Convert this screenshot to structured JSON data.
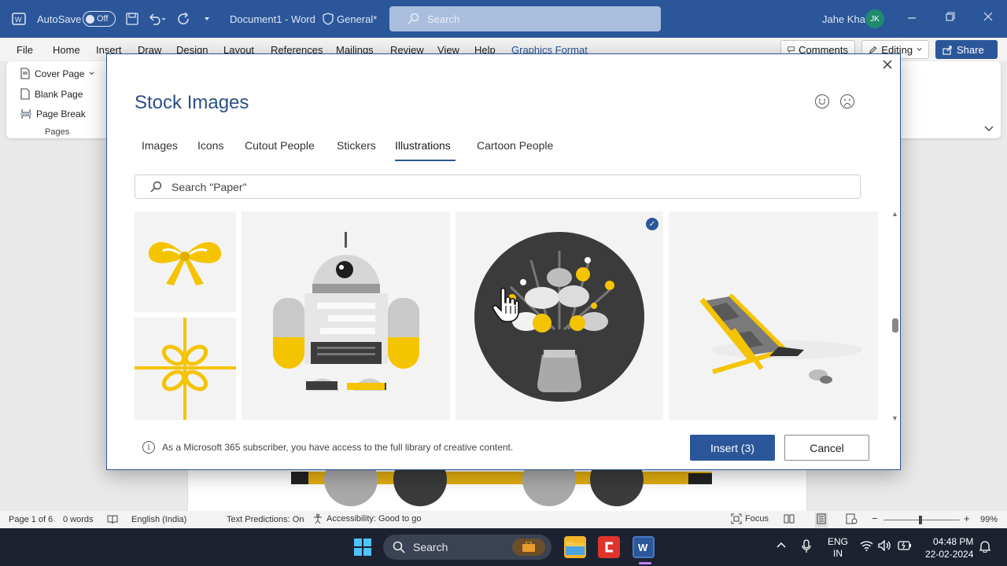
{
  "titlebar": {
    "autosave_label": "AutoSave",
    "autosave_state": "Off",
    "doc_title": "Document1 - Word",
    "sensitivity": "General*",
    "search_placeholder": "Search",
    "user_name": "Jahe Kha",
    "user_initials": "JK"
  },
  "ribbon": {
    "tabs": [
      "File",
      "Home",
      "Insert",
      "Draw",
      "Design",
      "Layout",
      "References",
      "Mailings",
      "Review",
      "View",
      "Help",
      "Graphics Format"
    ],
    "comments": "Comments",
    "editing": "Editing",
    "share": "Share",
    "pages": {
      "cover_page": "Cover Page",
      "blank_page": "Blank Page",
      "page_break": "Page Break",
      "group_label": "Pages"
    }
  },
  "dialog": {
    "title": "Stock Images",
    "tabs": [
      "Images",
      "Icons",
      "Cutout People",
      "Stickers",
      "Illustrations",
      "Cartoon People"
    ],
    "active_tab": "Illustrations",
    "search_text": "Search \"Paper\"",
    "items": [
      {
        "name": "yellow bow",
        "selected": false
      },
      {
        "name": "gift ribbon",
        "selected": false
      },
      {
        "name": "robot",
        "selected": false
      },
      {
        "name": "flower bouquet",
        "selected": true
      },
      {
        "name": "beach chair",
        "selected": false
      }
    ],
    "info_text": "As a Microsoft 365 subscriber, you have access to the full library of creative content.",
    "insert_label": "Insert (3)",
    "cancel_label": "Cancel"
  },
  "statusbar": {
    "page": "Page 1 of 6",
    "words": "0 words",
    "language": "English (India)",
    "predictions": "Text Predictions: On",
    "accessibility": "Accessibility: Good to go",
    "focus": "Focus",
    "zoom": "99%"
  },
  "taskbar": {
    "search": "Search",
    "lang_top": "ENG",
    "lang_bottom": "IN",
    "time": "04:48 PM",
    "date": "22-02-2024"
  },
  "colors": {
    "word_blue": "#2b579a",
    "accent_yellow": "#f5c400"
  }
}
